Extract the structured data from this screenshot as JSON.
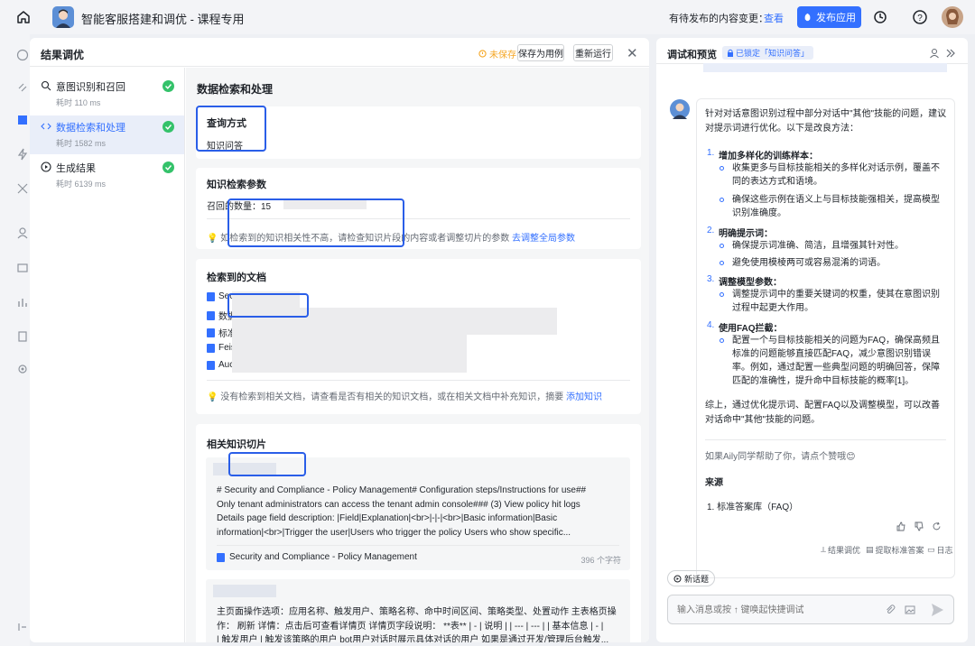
{
  "topbar": {
    "title": "智能客服搭建和调优 - 课程专用",
    "pending_text": "有待发布的内容变更：",
    "pending_link": "查看",
    "publish_label": "发布应用"
  },
  "panel": {
    "title": "结果调优",
    "unsaved": "未保存",
    "save_case": "保存为用例",
    "rerun": "重新运行"
  },
  "steps": [
    {
      "name": "意图识别和召回",
      "time": "耗时 110 ms"
    },
    {
      "name": "数据检索和处理",
      "time": "耗时 1582 ms"
    },
    {
      "name": "生成结果",
      "time": "耗时 6139 ms"
    }
  ],
  "content": {
    "title": "数据检索和处理",
    "query": {
      "label": "查询方式",
      "value": "知识问答"
    },
    "params": {
      "label": "知识检索参数",
      "recall_label": "召回的数量：",
      "recall_value": "15"
    },
    "params_tip": "如检索到的知识相关性不高，请检查知识片段的内容或者调整切片的参数",
    "params_tip_link": "去调整全局参数",
    "docs": {
      "label": "检索到的文档",
      "items": [
        "Sec",
        "数据",
        "标准",
        "Feis",
        "Auc"
      ]
    },
    "docs_tip": "没有检索到相关文档，请查看是否有相关的知识文档，或在相关文档中补充知识，摘要",
    "docs_tip_link": "添加知识",
    "chunks_label": "相关知识切片",
    "chunk1": {
      "lines": [
        "# Security and Compliance - Policy Management# Configuration steps/Instructions for use##",
        "Only tenant administrators can access the tenant admin console### (3) View policy hit logs",
        "Details page field description: |Field|Explanation|<br>|-|-|<br>|Basic information|Basic",
        "information|<br>|Trigger the user|Users who trigger the policy Users who show specific..."
      ],
      "source": "Security and Compliance - Policy Management",
      "chars": "396 个字符"
    },
    "chunk2": {
      "lines": [
        "主页面操作选项：应用名称、触发用户、策略名称、命中时间区间、策略类型、处置动作 主表格页操",
        "作：  刷新  详情：点击后可查看详情页  详情页字段说明：  **表** | - | 说明 | | --- | --- | | 基本信息 | - |",
        "| 触发用户 | 触发该策略的用户 bot用户对话时展示具体对话的用户 如果是通过开发/管理后台触发..."
      ]
    }
  },
  "right": {
    "title": "调试和预览",
    "lock_label": "已锁定「知识问答」",
    "intro": "针对对话意图识别过程中部分对话中\"其他\"技能的问题，建议对提示词进行优化。以下是改良方法：",
    "items": [
      {
        "num": "1.",
        "head": "增加多样化的训练样本：",
        "subs": [
          "收集更多与目标技能相关的多样化对话示例，覆盖不同的表达方式和语境。",
          "确保这些示例在语义上与目标技能强相关，提高模型识别准确度。"
        ]
      },
      {
        "num": "2.",
        "head": "明确提示词：",
        "subs": [
          "确保提示词准确、简洁，且增强其针对性。",
          "避免使用模棱两可或容易混淆的词语。"
        ]
      },
      {
        "num": "3.",
        "head": "调整模型参数：",
        "subs": [
          "调整提示词中的重要关键词的权重，使其在意图识别过程中起更大作用。"
        ]
      },
      {
        "num": "4.",
        "head": "使用FAQ拦截：",
        "subs": [
          "配置一个与目标技能相关的问题为FAQ，确保高频且标准的问题能够直接匹配FAQ，减少意图识别错误率。例如，通过配置一些典型问题的明确回答，保障匹配的准确性，提升命中目标技能的概率[1]。"
        ]
      }
    ],
    "summary": "综上，通过优化提示词、配置FAQ以及调整模型，可以改善对话命中\"其他\"技能的问题。",
    "helpful": "如果Aily同学帮助了你，请点个赞哦😊",
    "source_label": "来源",
    "source_item": "1. 标准答案库（FAQ）",
    "foot_tune": "结果调优",
    "foot_extract": "提取标准答案",
    "foot_log": "日志",
    "new_topic": "新话题",
    "input_placeholder": "输入消息或按 ↑ 键唤起快捷调试"
  }
}
